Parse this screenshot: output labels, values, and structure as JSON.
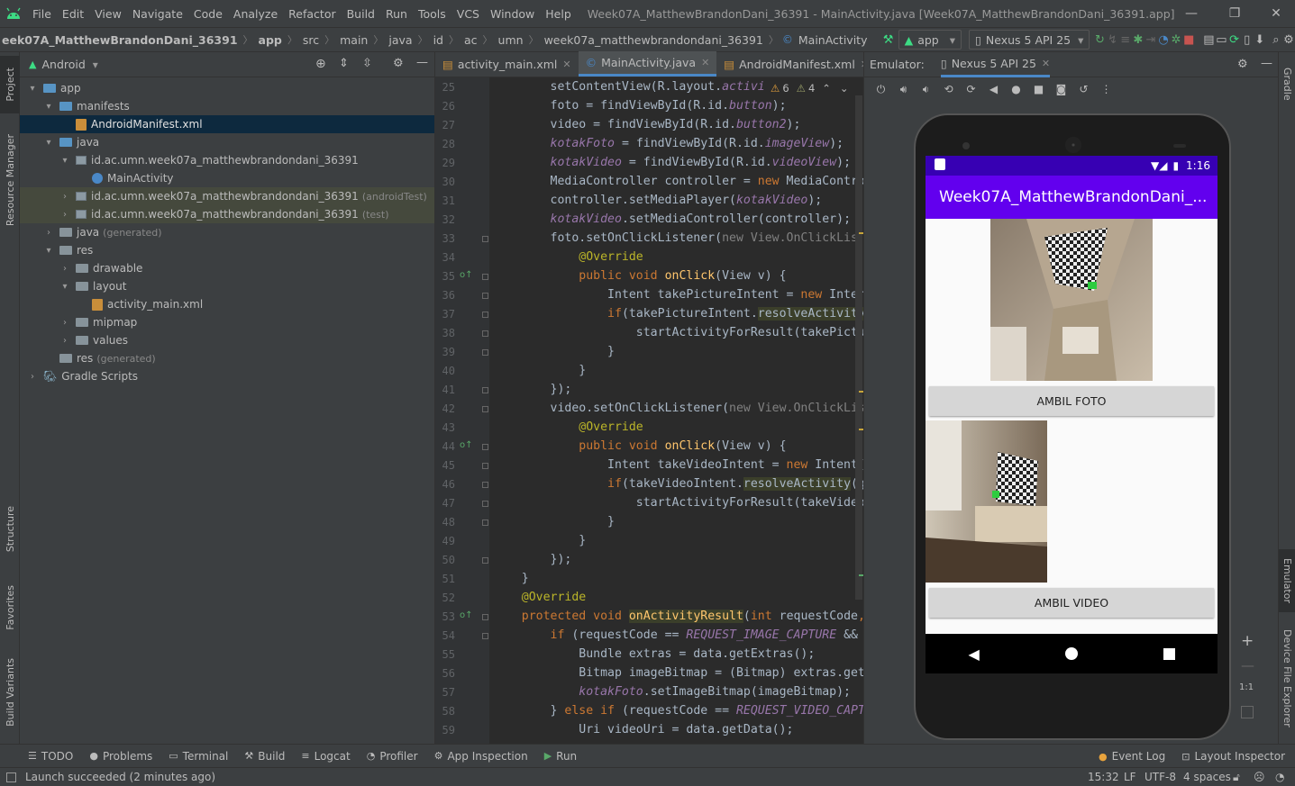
{
  "menubar": {
    "items": [
      "File",
      "Edit",
      "View",
      "Navigate",
      "Code",
      "Analyze",
      "Refactor",
      "Build",
      "Run",
      "Tools",
      "VCS",
      "Window",
      "Help"
    ],
    "title": "Week07A_MatthewBrandonDani_36391 - MainActivity.java [Week07A_MatthewBrandonDani_36391.app]"
  },
  "breadcrumb": [
    "eek07A_MatthewBrandonDani_36391",
    "app",
    "src",
    "main",
    "java",
    "id",
    "ac",
    "umn",
    "week07a_matthewbrandondani_36391",
    "MainActivity"
  ],
  "toolbar": {
    "run_config": "app",
    "device": "Nexus 5 API 25"
  },
  "project": {
    "view_mode": "Android",
    "tree": [
      {
        "label": "app",
        "suffix": "",
        "depth": 0,
        "arrow": "▾",
        "icon": "folder-blue"
      },
      {
        "label": "manifests",
        "suffix": "",
        "depth": 1,
        "arrow": "▾",
        "icon": "folder-blue"
      },
      {
        "label": "AndroidManifest.xml",
        "suffix": "",
        "depth": 2,
        "arrow": "",
        "icon": "manifest-file",
        "selected": true
      },
      {
        "label": "java",
        "suffix": "",
        "depth": 1,
        "arrow": "▾",
        "icon": "folder-blue"
      },
      {
        "label": "id.ac.umn.week07a_matthewbrandondani_36391",
        "suffix": "",
        "depth": 2,
        "arrow": "▾",
        "icon": "package"
      },
      {
        "label": "MainActivity",
        "suffix": "",
        "depth": 3,
        "arrow": "",
        "icon": "class-file"
      },
      {
        "label": "id.ac.umn.week07a_matthewbrandondani_36391",
        "suffix": "(androidTest)",
        "depth": 2,
        "arrow": "›",
        "icon": "package",
        "shaded": true
      },
      {
        "label": "id.ac.umn.week07a_matthewbrandondani_36391",
        "suffix": "(test)",
        "depth": 2,
        "arrow": "›",
        "icon": "package",
        "shaded": true
      },
      {
        "label": "java",
        "suffix": "(generated)",
        "depth": 1,
        "arrow": "›",
        "icon": "folder"
      },
      {
        "label": "res",
        "suffix": "",
        "depth": 1,
        "arrow": "▾",
        "icon": "folder"
      },
      {
        "label": "drawable",
        "suffix": "",
        "depth": 2,
        "arrow": "›",
        "icon": "folder"
      },
      {
        "label": "layout",
        "suffix": "",
        "depth": 2,
        "arrow": "▾",
        "icon": "folder"
      },
      {
        "label": "activity_main.xml",
        "suffix": "",
        "depth": 3,
        "arrow": "",
        "icon": "xml-file"
      },
      {
        "label": "mipmap",
        "suffix": "",
        "depth": 2,
        "arrow": "›",
        "icon": "folder"
      },
      {
        "label": "values",
        "suffix": "",
        "depth": 2,
        "arrow": "›",
        "icon": "folder"
      },
      {
        "label": "res",
        "suffix": "(generated)",
        "depth": 1,
        "arrow": "",
        "icon": "folder"
      },
      {
        "label": "Gradle Scripts",
        "suffix": "",
        "depth": 0,
        "arrow": "›",
        "icon": "gradle"
      }
    ]
  },
  "editor": {
    "tabs": [
      {
        "label": "activity_main.xml",
        "active": false
      },
      {
        "label": "MainActivity.java",
        "active": true
      },
      {
        "label": "AndroidManifest.xml",
        "active": false
      }
    ],
    "inspection": {
      "warnings": "6",
      "weak_warnings": "4"
    },
    "first_line": 25,
    "lines": [
      [
        [
          "        setContentView(R.layout.",
          ""
        ],
        [
          "activi",
          "f"
        ]
      ],
      [
        [
          "        foto = findViewById(R.id.",
          ""
        ],
        [
          "button",
          "f"
        ],
        [
          ");",
          ""
        ]
      ],
      [
        [
          "        video = findViewById(R.id.",
          ""
        ],
        [
          "button2",
          "f"
        ],
        [
          ");",
          ""
        ]
      ],
      [
        [
          "        ",
          ""
        ],
        [
          "kotakFoto",
          "f"
        ],
        [
          " = findViewById(R.id.",
          ""
        ],
        [
          "imageView",
          "f"
        ],
        [
          ");",
          ""
        ]
      ],
      [
        [
          "        ",
          ""
        ],
        [
          "kotakVideo",
          "f"
        ],
        [
          " = findViewById(R.id.",
          ""
        ],
        [
          "videoView",
          "f"
        ],
        [
          ");",
          ""
        ]
      ],
      [
        [
          "        MediaController controller = ",
          ""
        ],
        [
          "new ",
          "k"
        ],
        [
          "MediaContro",
          ""
        ]
      ],
      [
        [
          "        controller.setMediaPlayer(",
          ""
        ],
        [
          "kotakVideo",
          "f"
        ],
        [
          ");",
          ""
        ]
      ],
      [
        [
          "        ",
          ""
        ],
        [
          "kotakVideo",
          "f"
        ],
        [
          ".setMediaController(controller);",
          ""
        ]
      ],
      [
        [
          "        foto.setOnClickListener(",
          ""
        ],
        [
          "new View.OnClickLis",
          "c"
        ]
      ],
      [
        [
          "            ",
          ""
        ],
        [
          "@Override",
          "an"
        ]
      ],
      [
        [
          "            ",
          ""
        ],
        [
          "public void ",
          "k"
        ],
        [
          "onClick",
          "s"
        ],
        [
          "(View v) {",
          ""
        ]
      ],
      [
        [
          "                Intent takePictureIntent = ",
          ""
        ],
        [
          "new ",
          "k"
        ],
        [
          "Inter",
          ""
        ]
      ],
      [
        [
          "                ",
          ""
        ],
        [
          "if",
          "k"
        ],
        [
          "(takePictureIntent.",
          ""
        ],
        [
          "resolveActivity",
          "hl"
        ]
      ],
      [
        [
          "                    startActivityForResult(takePictu",
          ""
        ]
      ],
      [
        [
          "                }",
          ""
        ]
      ],
      [
        [
          "            }",
          ""
        ]
      ],
      [
        [
          "        });",
          ""
        ]
      ],
      [
        [
          "        video.setOnClickListener(",
          ""
        ],
        [
          "new View.OnClickLis",
          "c"
        ]
      ],
      [
        [
          "            ",
          ""
        ],
        [
          "@Override",
          "an"
        ]
      ],
      [
        [
          "            ",
          ""
        ],
        [
          "public void ",
          "k"
        ],
        [
          "onClick",
          "s"
        ],
        [
          "(View v) {",
          ""
        ]
      ],
      [
        [
          "                Intent takeVideoIntent = ",
          ""
        ],
        [
          "new ",
          "k"
        ],
        [
          "Intent(",
          ""
        ]
      ],
      [
        [
          "                ",
          ""
        ],
        [
          "if",
          "k"
        ],
        [
          "(takeVideoIntent.",
          ""
        ],
        [
          "resolveActivity",
          "hl"
        ],
        [
          "(g",
          ""
        ]
      ],
      [
        [
          "                    startActivityForResult(takeVideo",
          ""
        ]
      ],
      [
        [
          "                }",
          ""
        ]
      ],
      [
        [
          "            }",
          ""
        ]
      ],
      [
        [
          "        });",
          ""
        ]
      ],
      [
        [
          "    }",
          ""
        ]
      ],
      [
        [
          "    ",
          ""
        ],
        [
          "@Override",
          "an"
        ]
      ],
      [
        [
          "    ",
          ""
        ],
        [
          "protected void ",
          "k"
        ],
        [
          "onActivityResult",
          "s hl"
        ],
        [
          "(",
          ""
        ],
        [
          "int ",
          "k"
        ],
        [
          "requestCode",
          ""
        ],
        [
          ",",
          "k"
        ]
      ],
      [
        [
          "        ",
          ""
        ],
        [
          "if ",
          "k"
        ],
        [
          "(requestCode == ",
          ""
        ],
        [
          "REQUEST_IMAGE_CAPTURE",
          "f"
        ],
        [
          " &&",
          ""
        ]
      ],
      [
        [
          "            Bundle extras = data.getExtras();",
          ""
        ]
      ],
      [
        [
          "            Bitmap imageBitmap = (Bitmap) extras.get",
          ""
        ]
      ],
      [
        [
          "            ",
          ""
        ],
        [
          "kotakFoto",
          "f"
        ],
        [
          ".setImageBitmap(imageBitmap);",
          ""
        ]
      ],
      [
        [
          "        } ",
          ""
        ],
        [
          "else if ",
          "k"
        ],
        [
          "(requestCode == ",
          ""
        ],
        [
          "REQUEST_VIDEO_CAPT",
          "f"
        ]
      ],
      [
        [
          "            Uri videoUri = data.getData();",
          ""
        ]
      ]
    ]
  },
  "emulator": {
    "panel_title": "Emulator:",
    "device_tab": "Nexus 5 API 25",
    "time": "1:16",
    "app_title": "Week07A_MatthewBrandonDani_...",
    "foto_button": "AMBIL FOTO",
    "video_button": "AMBIL VIDEO",
    "zoom_reset": "1:1"
  },
  "side_tabs": {
    "left": [
      "Project",
      "Resource Manager",
      "Structure",
      "Favorites",
      "Build Variants"
    ],
    "right": [
      "Gradle",
      "Emulator",
      "Device File Explorer"
    ]
  },
  "bottom_tabs": [
    "TODO",
    "Problems",
    "Terminal",
    "Build",
    "Logcat",
    "Profiler",
    "App Inspection",
    "Run"
  ],
  "bottom_right": [
    "Event Log",
    "Layout Inspector"
  ],
  "status": {
    "message": "Launch succeeded (2 minutes ago)",
    "position": "15:32",
    "line_sep": "LF",
    "encoding": "UTF-8",
    "indent": "4 spaces"
  },
  "colors": {
    "accent": "#4a88c7",
    "app_primary": "#6200ee",
    "app_status": "#3700b3",
    "android_green": "#3ddc84"
  }
}
